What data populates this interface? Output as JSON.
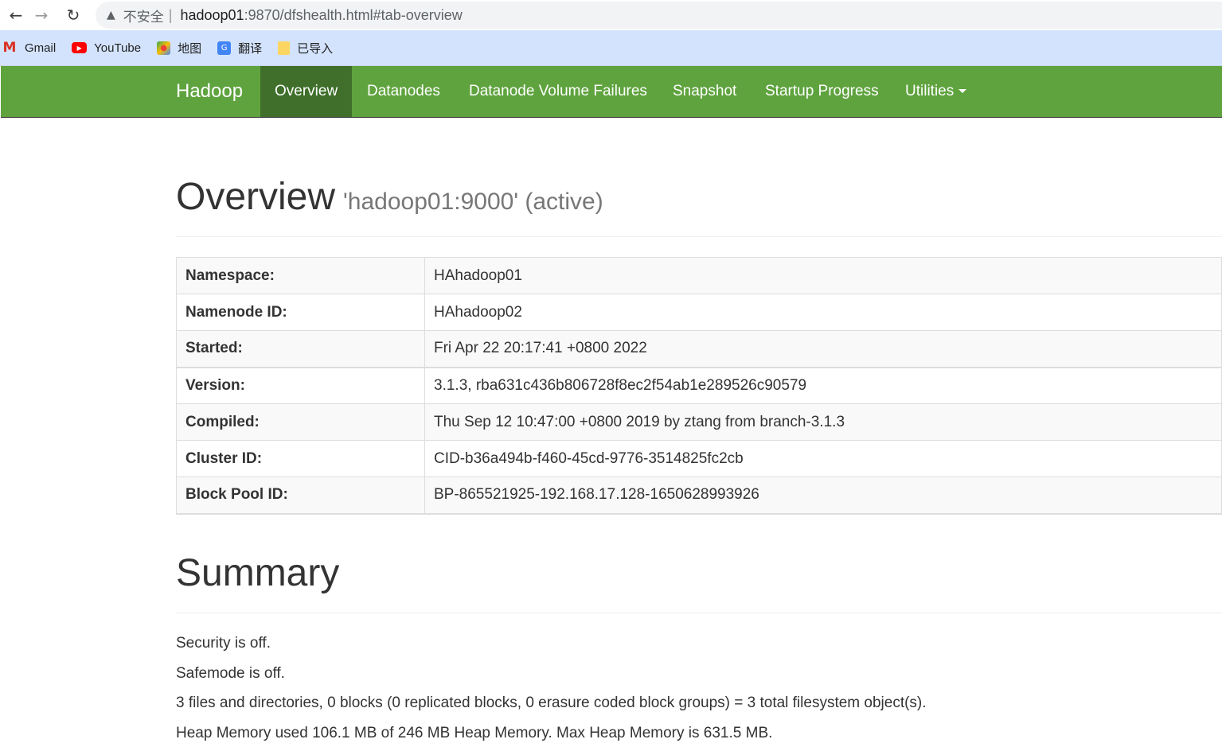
{
  "browser": {
    "back_icon": "arrow-left-icon",
    "forward_icon": "arrow-right-icon",
    "reload_icon": "reload-icon",
    "security_label": "不安全",
    "url_host": "hadoop01",
    "url_rest": ":9870/dfshealth.html#tab-overview"
  },
  "bookmarks": [
    {
      "label": "Gmail",
      "icon": "gmail-icon"
    },
    {
      "label": "YouTube",
      "icon": "youtube-icon"
    },
    {
      "label": "地图",
      "icon": "maps-icon"
    },
    {
      "label": "翻译",
      "icon": "translate-icon"
    },
    {
      "label": "已导入",
      "icon": "folder-icon"
    }
  ],
  "navbar": {
    "brand": "Hadoop",
    "items": [
      "Overview",
      "Datanodes",
      "Datanode Volume Failures",
      "Snapshot",
      "Startup Progress",
      "Utilities"
    ],
    "active": "Overview",
    "color": "#5fa33e",
    "active_color": "#3f6f2a"
  },
  "overview": {
    "title": "Overview",
    "subtitle": "'hadoop01:9000' (active)",
    "rows": [
      {
        "key": "Namespace:",
        "value": "HAhadoop01"
      },
      {
        "key": "Namenode ID:",
        "value": "HAhadoop02"
      },
      {
        "key": "Started:",
        "value": "Fri Apr 22 20:17:41 +0800 2022"
      },
      {
        "key": "Version:",
        "value": "3.1.3, rba631c436b806728f8ec2f54ab1e289526c90579"
      },
      {
        "key": "Compiled:",
        "value": "Thu Sep 12 10:47:00 +0800 2019 by ztang from branch-3.1.3"
      },
      {
        "key": "Cluster ID:",
        "value": "CID-b36a494b-f460-45cd-9776-3514825fc2cb"
      },
      {
        "key": "Block Pool ID:",
        "value": "BP-865521925-192.168.17.128-1650628993926"
      }
    ]
  },
  "summary": {
    "title": "Summary",
    "lines": [
      "Security is off.",
      "Safemode is off.",
      "3 files and directories, 0 blocks (0 replicated blocks, 0 erasure coded block groups) = 3 total filesystem object(s).",
      "Heap Memory used 106.1 MB of 246 MB Heap Memory. Max Heap Memory is 631.5 MB."
    ]
  }
}
